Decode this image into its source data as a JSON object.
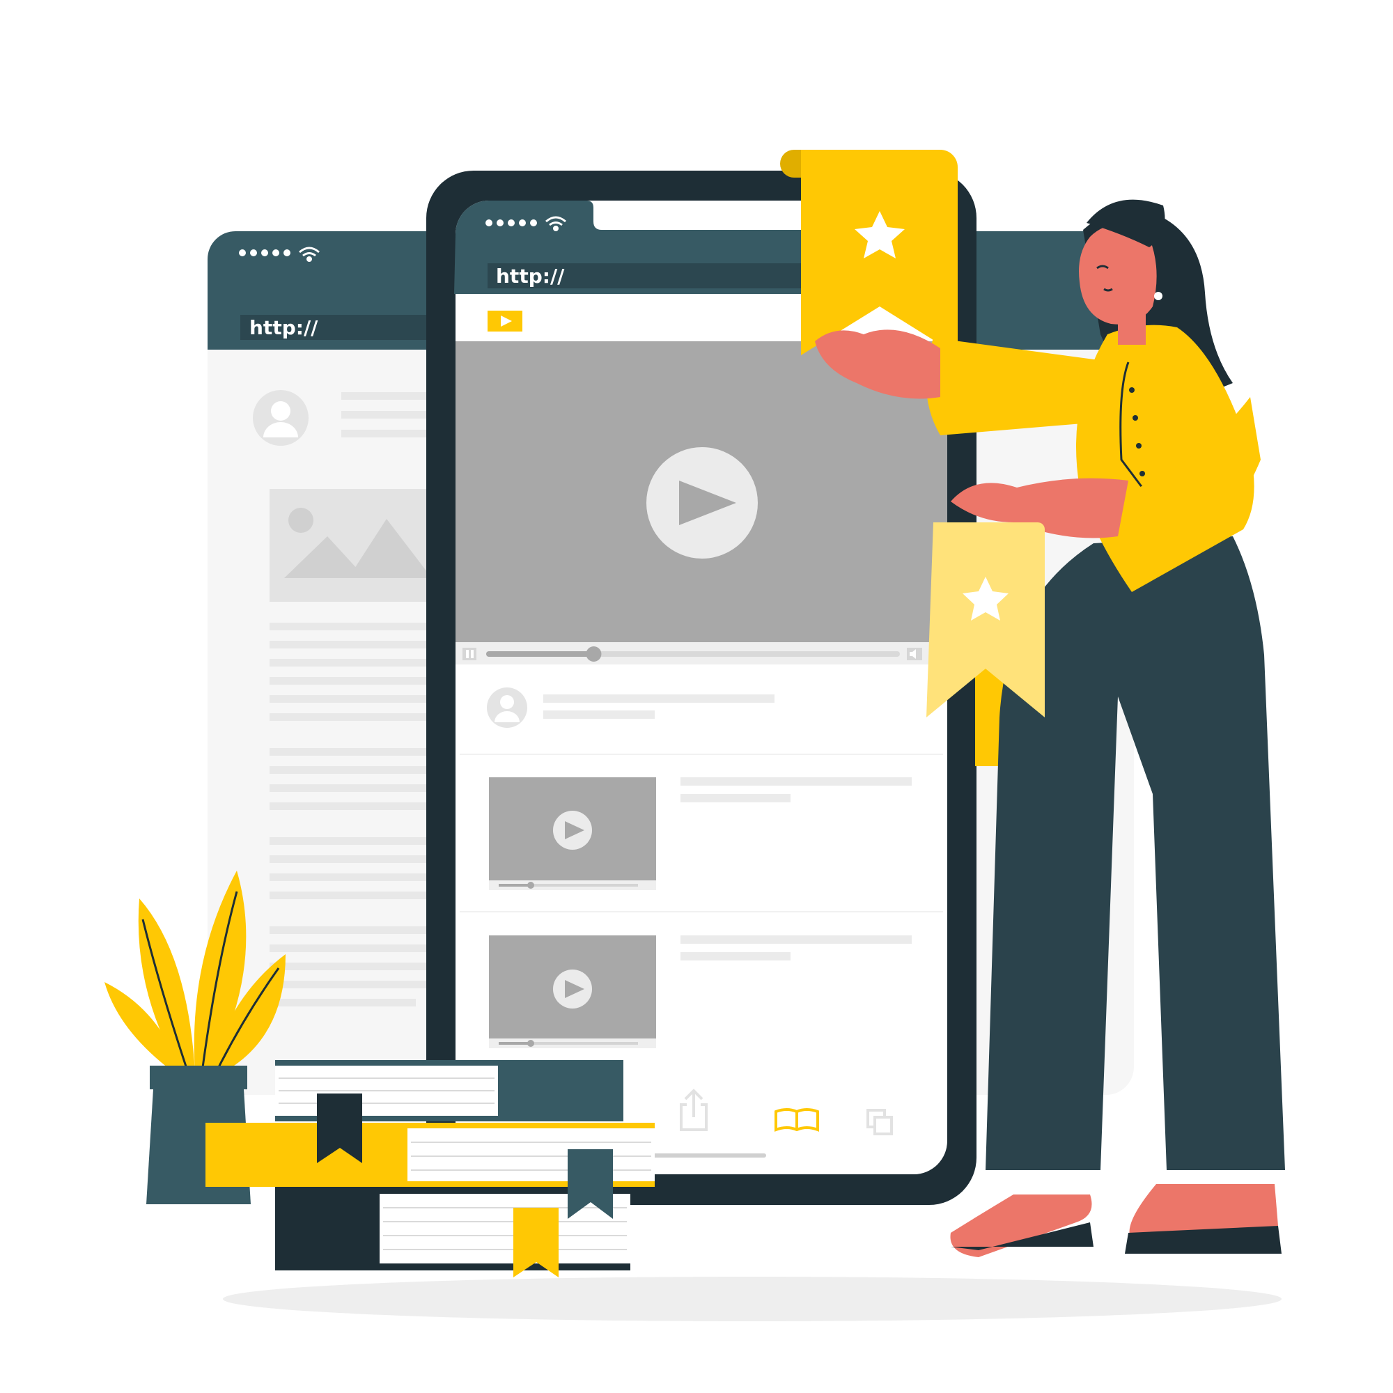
{
  "back_browser": {
    "url_text": "http://"
  },
  "phone": {
    "url_text": "http://",
    "video": {
      "progress": 0.26
    },
    "list_videos": [
      {
        "progress": 0.23
      },
      {
        "progress": 0.23
      }
    ],
    "tabbar": {
      "icons": [
        "share-icon",
        "book-icon",
        "copy-icon"
      ],
      "active_index": 1
    }
  },
  "colors": {
    "accent": "#FFC804",
    "accent_light": "#FFE27A",
    "dark": "#1E2E36",
    "dark_teal": "#375A64",
    "skin": "#EC7669",
    "video_gray": "#A8A8A8",
    "light_gray": "#EBEBEB"
  }
}
